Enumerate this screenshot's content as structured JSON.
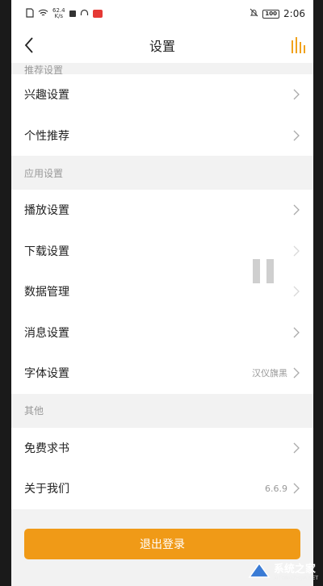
{
  "status_bar": {
    "net_speed_value": "62.4",
    "net_speed_unit": "K/s",
    "battery": "100",
    "time": "2:06"
  },
  "header": {
    "title": "设置"
  },
  "sections": {
    "recommend": {
      "title": "推荐设置",
      "items": [
        {
          "label": "兴趣设置"
        },
        {
          "label": "个性推荐"
        }
      ]
    },
    "app": {
      "title": "应用设置",
      "items": [
        {
          "label": "播放设置"
        },
        {
          "label": "下载设置"
        },
        {
          "label": "数据管理"
        },
        {
          "label": "消息设置"
        },
        {
          "label": "字体设置",
          "value": "汉仪旗黑"
        }
      ]
    },
    "other": {
      "title": "其他",
      "items": [
        {
          "label": "免费求书"
        },
        {
          "label": "关于我们",
          "value": "6.6.9"
        }
      ]
    }
  },
  "logout_label": "退出登录",
  "watermark": {
    "text": "系统之家",
    "sub": "XITONGZHIJIA.NET"
  },
  "colors": {
    "accent": "#f09a17",
    "background": "#f2f2f2",
    "text": "#222222",
    "muted": "#999999"
  },
  "icons": [
    "back-arrow-icon",
    "audio-bars-icon",
    "chevron-right-icon",
    "pause-icon",
    "wifi-icon",
    "headphones-icon",
    "mute-icon",
    "battery-icon"
  ]
}
